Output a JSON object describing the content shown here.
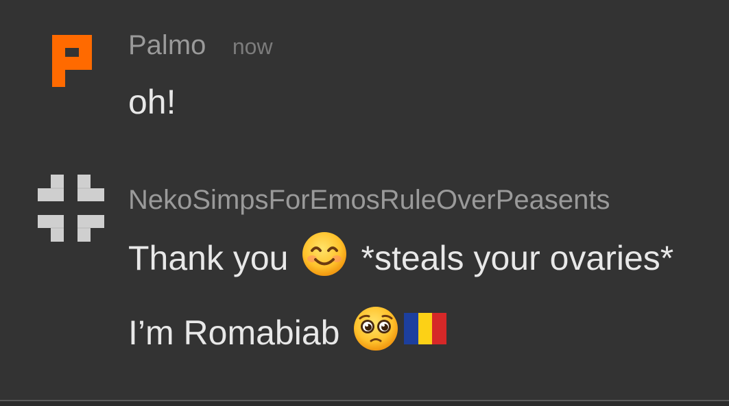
{
  "messages": [
    {
      "username": "Palmo",
      "timestamp": "now",
      "avatar_icon": "orange-p-block-icon",
      "avatar_color": "#ff6a00",
      "lines": [
        {
          "text": "oh!"
        }
      ]
    },
    {
      "username": "NekoSimpsForEmosRuleOverPeasents",
      "avatar_icon": "gray-cross-block-icon",
      "avatar_color": "#cfcfcf",
      "lines": [
        {
          "before": "Thank you",
          "emoji": "smiling-face-emoji",
          "after": "*steals your ovaries*"
        },
        {
          "before": "I’m Romabiab",
          "emoji": "pleading-face-emoji",
          "flag": "romania-flag-emoji"
        }
      ]
    }
  ]
}
